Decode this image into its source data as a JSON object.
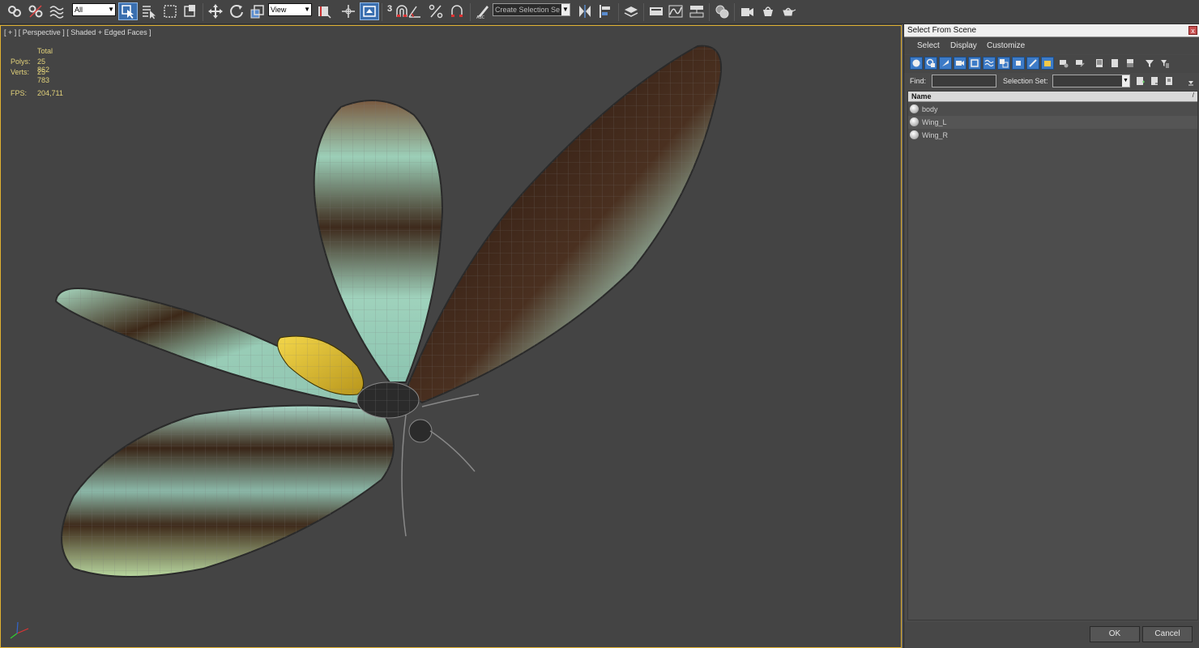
{
  "toolbar": {
    "filter_value": "All",
    "refcoord_value": "View",
    "snap_label": "3",
    "named_selection_placeholder": "Create Selection Se"
  },
  "viewport": {
    "label": "[ + ] [ Perspective ] [ Shaded + Edged Faces ]",
    "stats": {
      "total_label": "Total",
      "polys_label": "Polys:",
      "polys_value": "25 862",
      "verts_label": "Verts:",
      "verts_value": "25 783",
      "fps_label": "FPS:",
      "fps_value": "204,711"
    }
  },
  "dialog": {
    "title": "Select From Scene",
    "close_glyph": "x",
    "menu": [
      "Select",
      "Display",
      "Customize"
    ],
    "find_label": "Find:",
    "find_value": "",
    "selection_set_label": "Selection Set:",
    "selection_set_value": "",
    "column_name": "Name",
    "column_sort_glyph": "/",
    "objects": [
      "body",
      "Wing_L",
      "Wing_R"
    ],
    "ok_label": "OK",
    "cancel_label": "Cancel"
  },
  "colors": {
    "accent_blue": "#3d7bc7",
    "viewport_border": "#e0b030",
    "stats_text": "#e2d27a",
    "wing_green": "#a8d8c0",
    "wing_dark": "#3a2418",
    "body_yellow": "#e8c530"
  }
}
